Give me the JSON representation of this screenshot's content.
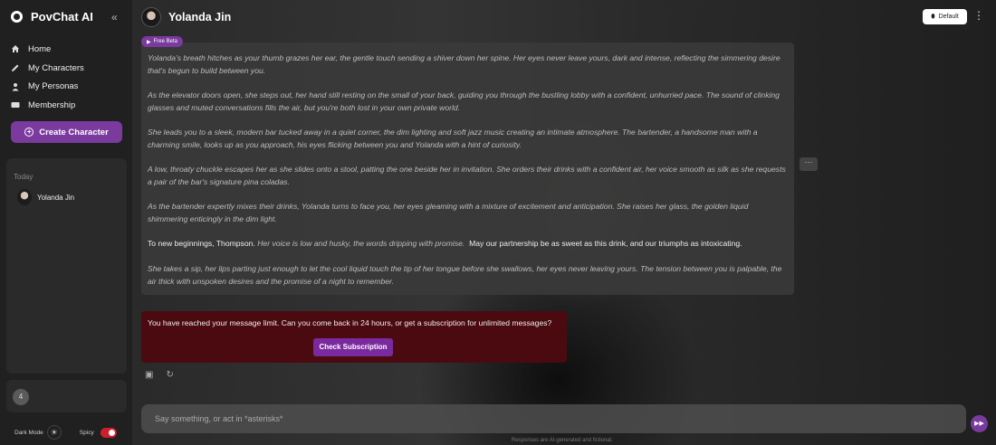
{
  "sidebar": {
    "brand": "PovChat AI",
    "nav": [
      {
        "label": "Home",
        "icon": "home-icon"
      },
      {
        "label": "My Characters",
        "icon": "pencil-icon"
      },
      {
        "label": "My Personas",
        "icon": "person-icon"
      },
      {
        "label": "Membership",
        "icon": "card-icon"
      }
    ],
    "create_label": "Create Character",
    "history_title": "Today",
    "history_item": "Yolanda Jin",
    "counter": "4",
    "dark_mode_label": "Dark Mode",
    "spicy_label": "Spicy"
  },
  "header": {
    "character_name": "Yolanda Jin",
    "default_label": "Default",
    "badge": "Free Beta"
  },
  "message": {
    "p1": "Yolanda's breath hitches as your thumb grazes her ear, the gentle touch sending a shiver down her spine. Her eyes never leave yours, dark and intense, reflecting the simmering desire that's begun to build between you.",
    "p2": "As the elevator doors open, she steps out, her hand still resting on the small of your back, guiding you through the bustling lobby with a confident, unhurried pace. The sound of clinking glasses and muted conversations fills the air, but you're both lost in your own private world.",
    "p3": "She leads you to a sleek, modern bar tucked away in a quiet corner, the dim lighting and soft jazz music creating an intimate atmosphere. The bartender, a handsome man with a charming smile, looks up as you approach, his eyes flicking between you and Yolanda with a hint of curiosity.",
    "p4": "A low, throaty chuckle escapes her as she slides onto a stool, patting the one beside her in invitation. She orders their drinks with a confident air, her voice smooth as silk as she requests a pair of the bar's signature pina coladas.",
    "p5": "As the bartender expertly mixes their drinks, Yolanda turns to face you, her eyes gleaming with a mixture of excitement and anticipation. She raises her glass, the golden liquid shimmering enticingly in the dim light.",
    "p6_a": "To new beginnings, Thompson.",
    "p6_b": "Her voice is low and husky, the words dripping with promise.",
    "p6_c": "May our partnership be as sweet as this drink, and our triumphs as intoxicating.",
    "p7": "She takes a sip, her lips parting just enough to let the cool liquid touch the tip of her tongue before she swallows, her eyes never leaving yours. The tension between you is palpable, the air thick with unspoken desires and the promise of a night to remember."
  },
  "limit": {
    "text": "You have reached your message limit. Can you come back in 24 hours, or get a subscription for unlimited messages?",
    "button": "Check Subscription"
  },
  "composer": {
    "placeholder": "Say something, or act in *asterisks*",
    "disclaimer": "Responses are AI-generated and fictional."
  },
  "colors": {
    "accent": "#7a3a9e",
    "limit_bg": "#4a0a10",
    "toggle_on": "#d01d2c"
  }
}
